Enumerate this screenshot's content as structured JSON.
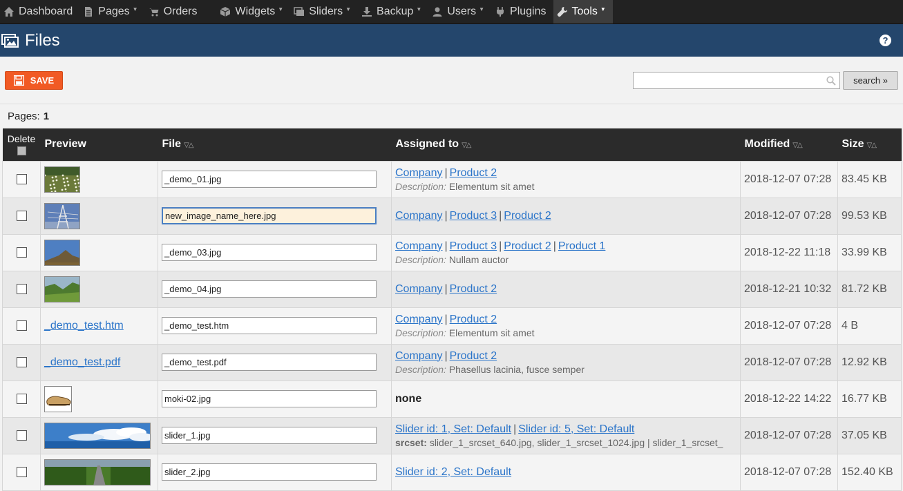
{
  "nav": [
    {
      "label": "Dashboard",
      "icon": "home-icon",
      "caret": false,
      "active": false
    },
    {
      "label": "Pages",
      "icon": "document-icon",
      "caret": true,
      "active": false
    },
    {
      "label": "Orders",
      "icon": "cart-icon",
      "caret": false,
      "active": false
    },
    {
      "label": "Widgets",
      "icon": "cube-icon",
      "caret": true,
      "active": false
    },
    {
      "label": "Sliders",
      "icon": "images-icon",
      "caret": true,
      "active": false
    },
    {
      "label": "Backup",
      "icon": "download-icon",
      "caret": true,
      "active": false
    },
    {
      "label": "Users",
      "icon": "user-icon",
      "caret": true,
      "active": false
    },
    {
      "label": "Plugins",
      "icon": "plug-icon",
      "caret": false,
      "active": false
    },
    {
      "label": "Tools",
      "icon": "wrench-icon",
      "caret": true,
      "active": true
    }
  ],
  "header": {
    "title": "Files",
    "icon": "images-icon",
    "help_label": "?"
  },
  "toolbar": {
    "save_label": "SAVE",
    "search_placeholder": "",
    "search_label": "search »"
  },
  "pagination": {
    "label": "Pages:",
    "count": "1"
  },
  "columns": {
    "delete": "Delete",
    "preview": "Preview",
    "file": "File",
    "assigned": "Assigned to",
    "modified": "Modified",
    "size": "Size",
    "sort_glyph": "▽△"
  },
  "assigned_separator": "|",
  "description_label": "Description:",
  "srcset_label": "srcset:",
  "rows": [
    {
      "preview_type": "image",
      "thumb": "flowers",
      "thumb_w": 52,
      "file": "_demo_01.jpg",
      "focused": false,
      "assigned": [
        "Company",
        "Product 2"
      ],
      "description": "Elementum sit amet",
      "modified": "2018-12-07 07:28",
      "size": "83.45 KB"
    },
    {
      "preview_type": "image",
      "thumb": "tower",
      "thumb_w": 52,
      "file": "new_image_name_here.jpg",
      "focused": true,
      "assigned": [
        "Company",
        "Product 3",
        "Product 2"
      ],
      "description": "",
      "modified": "2018-12-07 07:28",
      "size": "99.53 KB"
    },
    {
      "preview_type": "image",
      "thumb": "hill",
      "thumb_w": 52,
      "file": "_demo_03.jpg",
      "focused": false,
      "assigned": [
        "Company",
        "Product 3",
        "Product 2",
        "Product 1"
      ],
      "description": "Nullam auctor",
      "modified": "2018-12-22 11:18",
      "size": "33.99 KB"
    },
    {
      "preview_type": "image",
      "thumb": "valley",
      "thumb_w": 52,
      "file": "_demo_04.jpg",
      "focused": false,
      "assigned": [
        "Company",
        "Product 2"
      ],
      "description": "",
      "modified": "2018-12-21 10:32",
      "size": "81.72 KB"
    },
    {
      "preview_type": "link",
      "preview_text": "_demo_test.htm",
      "file": "_demo_test.htm",
      "focused": false,
      "assigned": [
        "Company",
        "Product 2"
      ],
      "description": "Elementum sit amet",
      "modified": "2018-12-07 07:28",
      "size": "4 B"
    },
    {
      "preview_type": "link",
      "preview_text": "_demo_test.pdf",
      "file": "_demo_test.pdf",
      "focused": false,
      "assigned": [
        "Company",
        "Product 2"
      ],
      "description": "Phasellus lacinia, fusce semper",
      "modified": "2018-12-07 07:28",
      "size": "12.92 KB"
    },
    {
      "preview_type": "image",
      "thumb": "shoe",
      "thumb_w": 40,
      "file": "moki-02.jpg",
      "focused": false,
      "assigned_none": "none",
      "modified": "2018-12-22 14:22",
      "size": "16.77 KB"
    },
    {
      "preview_type": "image",
      "thumb": "sky",
      "thumb_w": 154,
      "file": "slider_1.jpg",
      "focused": false,
      "assigned": [
        "Slider id: 1, Set: Default",
        "Slider id: 5, Set: Default"
      ],
      "srcset": "slider_1_srcset_640.jpg, slider_1_srcset_1024.jpg | slider_1_srcset_",
      "modified": "2018-12-07 07:28",
      "size": "37.05 KB"
    },
    {
      "preview_type": "image",
      "thumb": "road",
      "thumb_w": 154,
      "file": "slider_2.jpg",
      "focused": false,
      "assigned": [
        "Slider id: 2, Set: Default"
      ],
      "description": "",
      "modified": "2018-12-07 07:28",
      "size": "152.40 KB"
    }
  ]
}
